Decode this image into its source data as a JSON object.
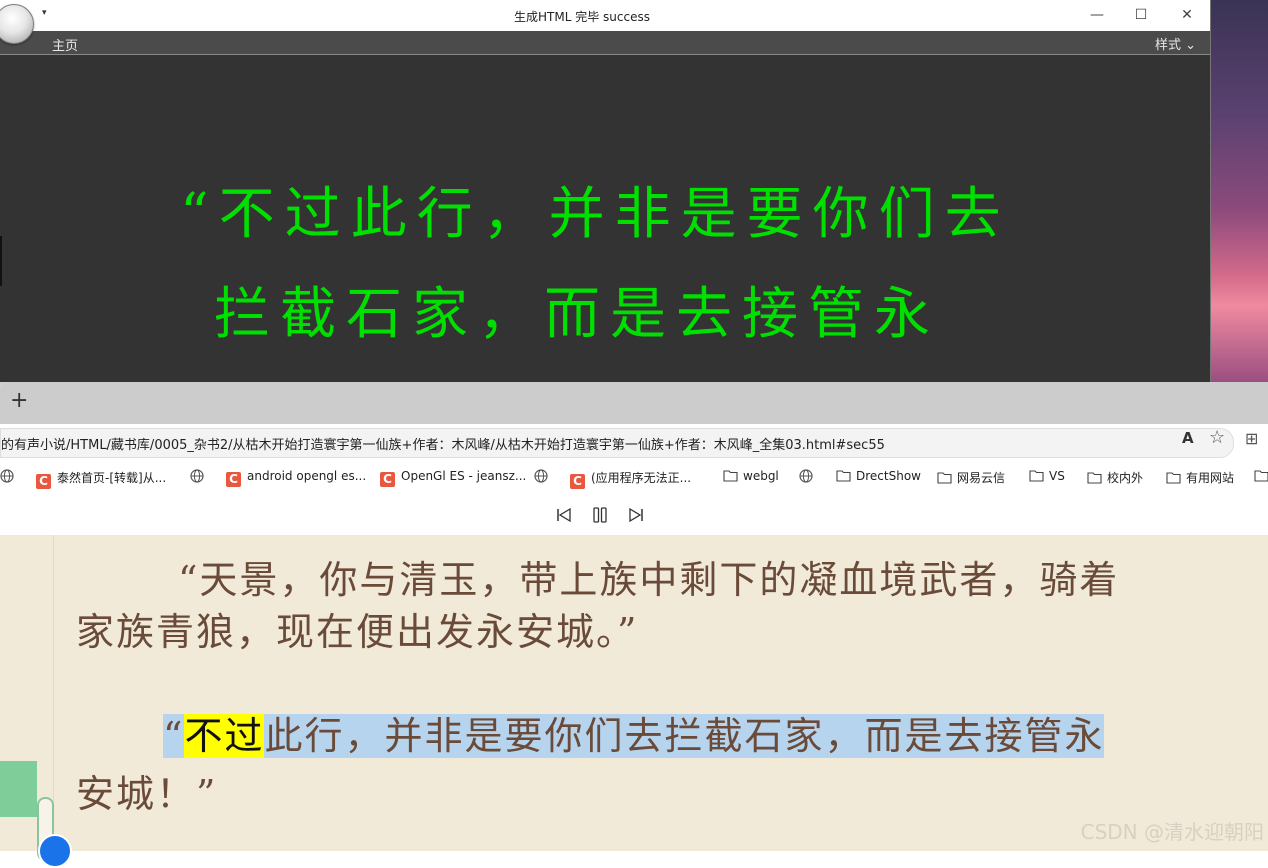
{
  "app": {
    "title": "生成HTML 完毕 success",
    "menu_home": "主页",
    "menu_style": "样式 ⌄",
    "quick_access": "▾",
    "minimize": "—",
    "maximize": "☐",
    "close": "✕",
    "render_line1": "“不过此行，并非是要你们去",
    "render_line2": "拦截石家，而是去接管永",
    "render_color": "#00e000",
    "render_bg": "#333333"
  },
  "browser": {
    "new_tab": "+",
    "address": "的有声小说/HTML/藏书库/0005_杂书2/从枯木开始打造寰宇第一仙族+作者：木风峰/从枯木开始打造寰宇第一仙族+作者：木风峰_全集03.html#sec55",
    "read_aloud_icon": "A",
    "favorite_icon": "☆",
    "extensions_icon": "⊞",
    "bookmarks": [
      {
        "type": "csdn",
        "label": "泰然首页-[转载]从..."
      },
      {
        "type": "csdn",
        "label": "android opengl es..."
      },
      {
        "type": "csdn",
        "label": "OpenGl ES - jeansz..."
      },
      {
        "type": "csdn",
        "label": "(应用程序无法正..."
      },
      {
        "type": "folder",
        "label": "webgl"
      },
      {
        "type": "folder",
        "label": "DrectShow"
      },
      {
        "type": "folder",
        "label": "网易云信"
      },
      {
        "type": "folder",
        "label": "VS"
      },
      {
        "type": "folder",
        "label": "校内外"
      },
      {
        "type": "folder",
        "label": "有用网站"
      }
    ]
  },
  "reader": {
    "para1_line1": "“天景，你与清玉，带上族中剩下的凝血境武者，骑着",
    "para1_line2": "家族青狼，现在便出发永安城。”",
    "para2_quote": "“",
    "para2_current_word": "不过",
    "para2_rest": "此行，并非是要你们去拦截石家，而是去接管永",
    "para2_line2": "安城！”",
    "highlight_color": "#b7d4ee",
    "word_highlight_color": "#ffff00",
    "text_color": "#6a4a38",
    "background": "#f1ead9"
  },
  "watermark": "CSDN @清水迎朝阳"
}
